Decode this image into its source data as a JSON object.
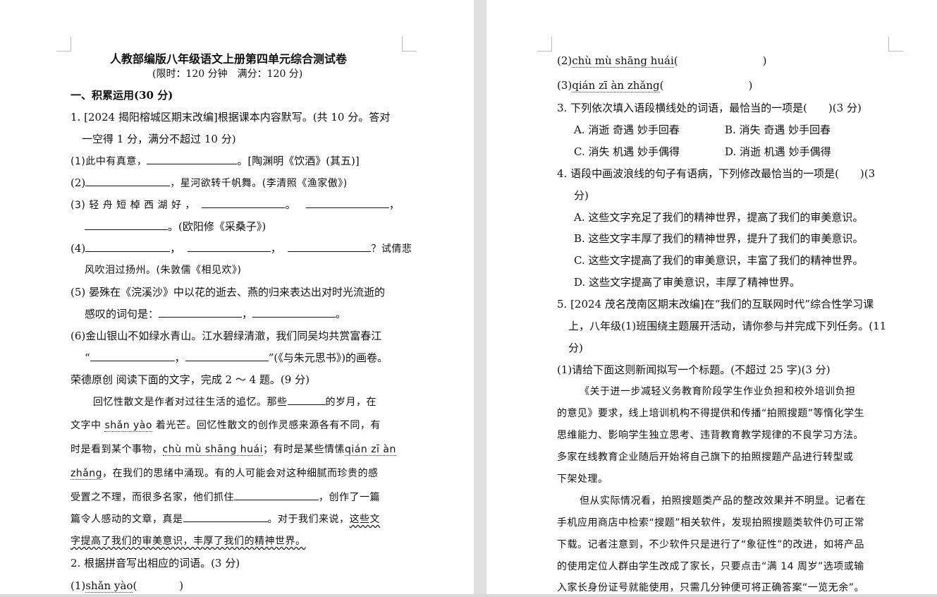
{
  "left": {
    "title": "人教部编版八年级语文上册第四单元综合测试卷",
    "subtitle": "(限时：120 分钟　满分：120 分)",
    "section1": "一、积累运用(30 分)",
    "q1a": "1. [2024  揭阳榕城区期末改编]根据课本内容默写。(共 10 分。答对",
    "q1b": "一空得 1 分，满分不超过 10 分)",
    "q1_1a": "(1)此中有真意，",
    "q1_1b": "。[陶渊明《饮酒》(其五)]",
    "q1_2a": "(2)",
    "q1_2b": "，星河欲转千帆舞。(李清照《渔家傲》)",
    "q1_3a": "(3) 轻 舟 短 棹 西 湖 好 ，",
    "q1_3b": "。",
    "q1_3c": "，",
    "q1_3d": "。(欧阳修《采桑子》)",
    "q1_4a": "(4)",
    "q1_4b": "，",
    "q1_4c": "，",
    "q1_4d": "？试倩悲",
    "q1_4e": "风吹泪过扬州。(朱敦儒《相见欢》)",
    "q1_5a": "(5)  晏殊在《浣溪沙》中以花的逝去、燕的归来表达出对时光流逝的",
    "q1_5b": "感叹的词句是：",
    "q1_5c": "，",
    "q1_5d": "。",
    "q1_6a": "(6)金山银山不如绿水青山。江水碧绿清澈，我们同吴均共赏富春江",
    "q1_6b": "“",
    "q1_6c": "，",
    "q1_6d": "”(《与朱元思书》)的画卷。",
    "intro": "荣德原创  阅读下面的文字，完成 2 ～ 4 题。(9 分)",
    "p1a": "回忆性散文是作者对过往生活的追忆。那些",
    "p1b": "的岁月，在",
    "p2a": "文字中",
    "p2py": "shǎn yào",
    "p2b": "着光芒。回忆性散文的创作灵感来源各有不同，有",
    "p3a": "时是看到某个事物，",
    "p3py": "chù mù shāng huái",
    "p3b": "；有时是某些情愫",
    "p3py2": "qián zī  àn",
    "p4py": "zhǎng",
    "p4b": "，在我们的思绪中涌现。有的人可能会对这种细腻而珍贵的感",
    "p5a": "受置之不理，而很多名家，他们抓住",
    "p5b": "，创作了一篇",
    "p6a": "篇令人感动的文章，真是",
    "p6b": "。对于我们来说，",
    "p6c": "这些文",
    "p7": "字提高了我们的审美意识，丰厚了我们的精神世界。",
    "q2": "2. 根据拼音写出相应的词语。(3 分)",
    "q2_1a": "(1)",
    "q2_1py": "shǎn yào",
    "q2_1b": "(　　　　)"
  },
  "right": {
    "q2_2a": "(2)",
    "q2_2py": "chù mù shāng huái",
    "q2_2b": "(　　　　　　　　)",
    "q2_3a": "(3)",
    "q2_3py": "qián zī  àn zhǎng",
    "q2_3b": "(　　　　　　　　)",
    "q3": "3.  下列依次填入语段横线处的词语，最恰当的一项是(　　)(3 分)",
    "q3A": "A. 消逝  奇遇  妙手回春",
    "q3B": "B. 消失  奇遇  妙手回春",
    "q3C": "C. 消失  机遇  妙手偶得",
    "q3D": "D. 消逝  机遇  妙手偶得",
    "q4a": "4.  语段中画波浪线的句子有语病，下列修改最恰当的一项是(　　)(3",
    "q4b": "分)",
    "q4A": "A. 这些文字充足了我们的精神世界，提高了我们的审美意识。",
    "q4B": "B. 这些文字丰厚了我们的精神世界，提升了我们的审美意识。",
    "q4C": "C. 这些文字提高了我们的审美意识，丰富了我们的精神世界。",
    "q4D": "D. 这些文字提高了审美意识，丰厚了精神世界。",
    "q5a": "5. [2024  茂名茂南区期末改编]在“我们的互联网时代”综合性学习课",
    "q5b": "上，八年级(1)班围绕主题展开活动，请你参与并完成下列任务。(11",
    "q5c": "分)",
    "q5_1": "(1)请给下面这则新闻拟写一个标题。(不超过 25 字)(3 分)",
    "n1": "《关于进一步减轻义务教育阶段学生作业负担和校外培训负担",
    "n2": "的意见》要求，线上培训机构不得提供和传播“拍照搜题”等惰化学生",
    "n3": "思维能力、影响学生独立思考、违背教育教学规律的不良学习方法。",
    "n4": "多家在线教育企业随后开始将自己旗下的拍照搜题产品进行转型或",
    "n5": "下架处理。",
    "n6": "但从实际情况看，拍照搜题类产品的整改效果并不明显。记者在",
    "n7": "手机应用商店中检索“搜题”相关软件，发现拍照搜题类软件仍可正常",
    "n8": "下载。记者注意到，不少软件只是进行了“象征性”的改进，如将产品",
    "n9": "的使用定位人群由学生改成了家长，只要点击“满 14 周岁”选项或输",
    "n10": "入家长身份证号就能使用，只需几分钟便可将正确答案“一览无余”。"
  }
}
